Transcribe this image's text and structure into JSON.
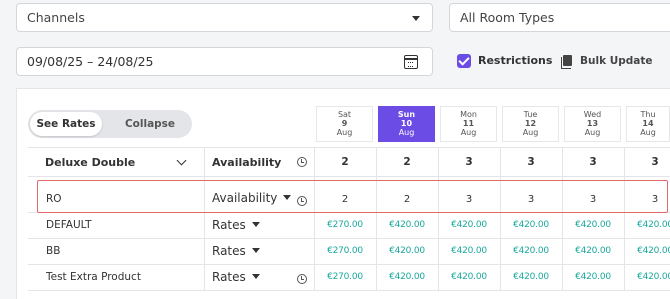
{
  "filters": {
    "channels": "Channels",
    "room_types": "All Room Types",
    "date_range": "09/08/25 – 24/08/25",
    "restrictions_label": "Restrictions",
    "restrictions_checked": true,
    "bulk_update": "Bulk Update"
  },
  "view_toggle": {
    "see_rates": "See Rates",
    "collapse": "Collapse"
  },
  "days": [
    {
      "weekday": "Sat",
      "num": "9",
      "month": "Aug"
    },
    {
      "weekday": "Sun",
      "num": "10",
      "month": "Aug"
    },
    {
      "weekday": "Mon",
      "num": "11",
      "month": "Aug"
    },
    {
      "weekday": "Tue",
      "num": "12",
      "month": "Aug"
    },
    {
      "weekday": "Wed",
      "num": "13",
      "month": "Aug"
    },
    {
      "weekday": "Thu",
      "num": "14",
      "month": "Aug"
    }
  ],
  "room": {
    "name": "Deluxe Double",
    "availability_label": "Availability",
    "availability": [
      "2",
      "2",
      "3",
      "3",
      "3",
      "3"
    ]
  },
  "rows": [
    {
      "label": "RO",
      "control": "Availability",
      "values": [
        "2",
        "2",
        "3",
        "3",
        "3",
        "3"
      ]
    },
    {
      "label": "DEFAULT",
      "control": "Rates",
      "values": [
        "€270.00",
        "€420.00",
        "€420.00",
        "€420.00",
        "€420.00",
        "€420.00"
      ]
    },
    {
      "label": "BB",
      "control": "Rates",
      "values": [
        "€270.00",
        "€420.00",
        "€420.00",
        "€420.00",
        "€420.00",
        "€420.00"
      ]
    },
    {
      "label": "Test Extra Product",
      "control": "Rates",
      "values": [
        "€270.00",
        "€420.00",
        "€420.00",
        "€420.00",
        "€420.00",
        "€420.00"
      ]
    }
  ],
  "colors": {
    "accent": "#6b4de6",
    "rate": "#1aa99c",
    "highlight": "#e36a6a"
  }
}
